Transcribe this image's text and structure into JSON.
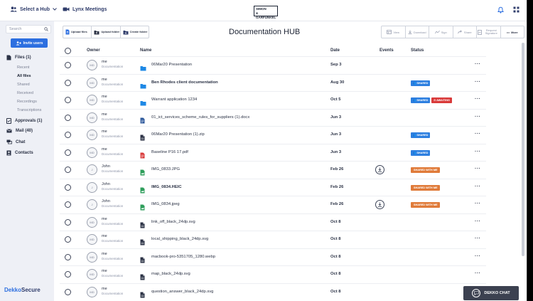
{
  "topbar": {
    "hub_select": "Select a Hub",
    "meetings": "Lynx Meetings",
    "logo_line1": "SIMON",
    "logo_line2": "& GARFUNKEL"
  },
  "sidebar": {
    "search_placeholder": "Search",
    "invite_label": "Invite users",
    "files_label": "Files (1)",
    "file_subitems": [
      "Recent",
      "All files",
      "Shared",
      "Received",
      "Recordings",
      "Transcriptions"
    ],
    "active_subitem": "All files",
    "approvals_label": "Approvals (1)",
    "mail_label": "Mail (40)",
    "chat_label": "Chat",
    "contacts_label": "Contacts",
    "brand_left": "Dekko",
    "brand_right": "Secure"
  },
  "toolbar": {
    "upload_files": "Upload files",
    "upload_folder": "Upload folder",
    "create_folder": "Create folder",
    "view": "View",
    "download": "Download",
    "sign": "Sign",
    "share": "Share",
    "request_signature": "Request Signature",
    "more": "More"
  },
  "page": {
    "title": "Documentation HUB"
  },
  "table": {
    "headers": {
      "owner": "Owner",
      "name": "Name",
      "date": "Date",
      "events": "Events",
      "status": "Status"
    },
    "rows": [
      {
        "owner": "me",
        "dept": "Documentation",
        "initials": "MD",
        "icon": "folder-icon",
        "name": "06Mar20 Presentation",
        "bold": false,
        "date": "Sep 3",
        "event": false,
        "badges": []
      },
      {
        "owner": "me",
        "dept": "Documentation",
        "initials": "MD",
        "icon": "folder-icon",
        "name": "Ben Rhodes client documentation",
        "bold": true,
        "date": "Aug 30",
        "event": false,
        "badges": [
          "SHARED"
        ]
      },
      {
        "owner": "me",
        "dept": "Documentation",
        "initials": "MD",
        "icon": "folder-icon",
        "name": "Warrant application 1234",
        "bold": false,
        "date": "Oct 5",
        "event": false,
        "badges": [
          "SHARED",
          "AWAITING"
        ]
      },
      {
        "owner": "me",
        "dept": "Documentation",
        "initials": "MD",
        "icon": "word-doc-icon",
        "name": "01_ict_services_scheme_rules_for_suppliers (1).docx",
        "bold": false,
        "date": "Jun 3",
        "event": false,
        "badges": []
      },
      {
        "owner": "me",
        "dept": "Documentation",
        "initials": "MD",
        "icon": "zip-file-icon",
        "name": "06Mar20 Presentation (1).zip",
        "bold": false,
        "date": "Jun 3",
        "event": false,
        "badges": [
          "SHARED"
        ]
      },
      {
        "owner": "me",
        "dept": "Documentation",
        "initials": "MD",
        "icon": "pdf-file-icon",
        "name": "Baseline P16 17.pdf",
        "bold": false,
        "date": "Jun 3",
        "event": false,
        "badges": [
          "SHARED"
        ]
      },
      {
        "owner": "John",
        "dept": "Documentation",
        "initials": "J",
        "icon": "image-file-icon",
        "name": "IMG_0833.JPG",
        "bold": false,
        "date": "Feb 26",
        "event": true,
        "badges": [
          "SHARED WITH ME"
        ]
      },
      {
        "owner": "John",
        "dept": "Documentation",
        "initials": "J",
        "icon": "image-file-icon",
        "name": "IMG_0834.HEIC",
        "bold": true,
        "date": "Feb 26",
        "event": false,
        "badges": [
          "SHARED WITH ME"
        ]
      },
      {
        "owner": "John",
        "dept": "Documentation",
        "initials": "J",
        "icon": "image-file-icon",
        "name": "IMG_0834.jpeg",
        "bold": false,
        "date": "Feb 26",
        "event": true,
        "badges": [
          "SHARED WITH ME"
        ]
      },
      {
        "owner": "me",
        "dept": "Documentation",
        "initials": "MD",
        "icon": "file-icon",
        "name": "link_off_black_24dp.svg",
        "bold": false,
        "date": "Oct 8",
        "event": false,
        "badges": []
      },
      {
        "owner": "me",
        "dept": "Documentation",
        "initials": "MD",
        "icon": "file-icon",
        "name": "local_shipping_black_24dp.svg",
        "bold": false,
        "date": "Oct 8",
        "event": false,
        "badges": []
      },
      {
        "owner": "me",
        "dept": "Documentation",
        "initials": "MD",
        "icon": "file-icon",
        "name": "macbook-pro-5351705_1280.webp",
        "bold": false,
        "date": "Oct 8",
        "event": false,
        "badges": []
      },
      {
        "owner": "me",
        "dept": "Documentation",
        "initials": "MD",
        "icon": "file-icon",
        "name": "map_black_24dp.svg",
        "bold": false,
        "date": "Oct 8",
        "event": false,
        "badges": []
      },
      {
        "owner": "me",
        "dept": "Documentation",
        "initials": "MD",
        "icon": "file-icon",
        "name": "question_answer_black_24dp.svg",
        "bold": false,
        "date": "Oct 8",
        "event": false,
        "badges": []
      }
    ]
  },
  "badge_colors": {
    "SHARED": "#2d7fe0",
    "AWAITING": "#d93a3a",
    "SHARED WITH ME": "#e07b3a"
  },
  "icon_colors": {
    "folder-icon": "#1e88e5",
    "word-doc-icon": "#2b579a",
    "zip-file-icon": "#2b3245",
    "pdf-file-icon": "#d93a3a",
    "image-file-icon": "#2e9e5b",
    "file-icon": "#2b3245"
  },
  "chat_widget": {
    "label": "DEKKO CHAT"
  }
}
